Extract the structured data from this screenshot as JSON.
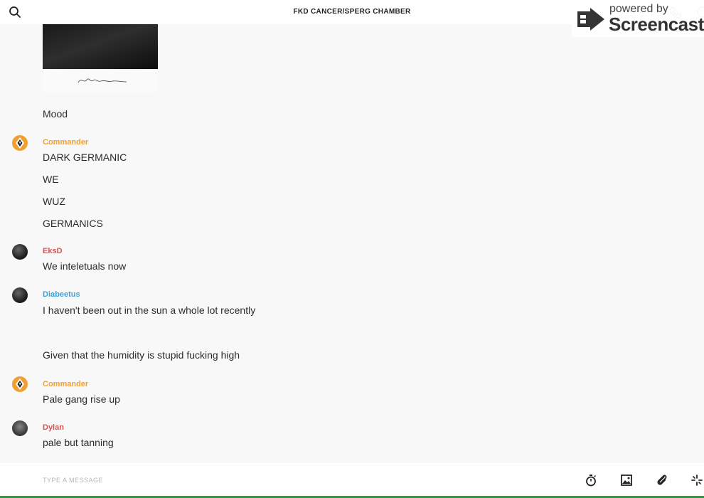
{
  "header": {
    "title": "FKD CANCER/SPERG CHAMBER"
  },
  "watermark": {
    "powered": "powered by",
    "brand": "Screencastify"
  },
  "attachment": {
    "caption": "Mood"
  },
  "messages": [
    {
      "sender": "Commander",
      "color": "#f0a030",
      "lines": [
        "DARK GERMANIC",
        "WE",
        "WUZ",
        "GERMANICS"
      ]
    },
    {
      "sender": "EksD",
      "color": "#d9534f",
      "lines": [
        "We inteletuals now"
      ]
    },
    {
      "sender": "Diabeetus",
      "color": "#3da3d6",
      "lines": [
        "I haven't been out in the sun a whole lot recently",
        "Given that the humidity is stupid fucking high"
      ]
    },
    {
      "sender": "Commander",
      "color": "#f0a030",
      "lines": [
        "Pale gang rise up"
      ]
    },
    {
      "sender": "Dylan",
      "color": "#d9534f",
      "lines": [
        "pale but tanning"
      ]
    }
  ],
  "composer": {
    "placeholder": "TYPE A MESSAGE"
  },
  "icons": {
    "search": "search-icon",
    "phone": "phone-icon",
    "info": "info-icon",
    "timer": "timer-icon",
    "image": "image-icon",
    "attach": "paperclip-icon",
    "more": "sparkle-icon"
  }
}
